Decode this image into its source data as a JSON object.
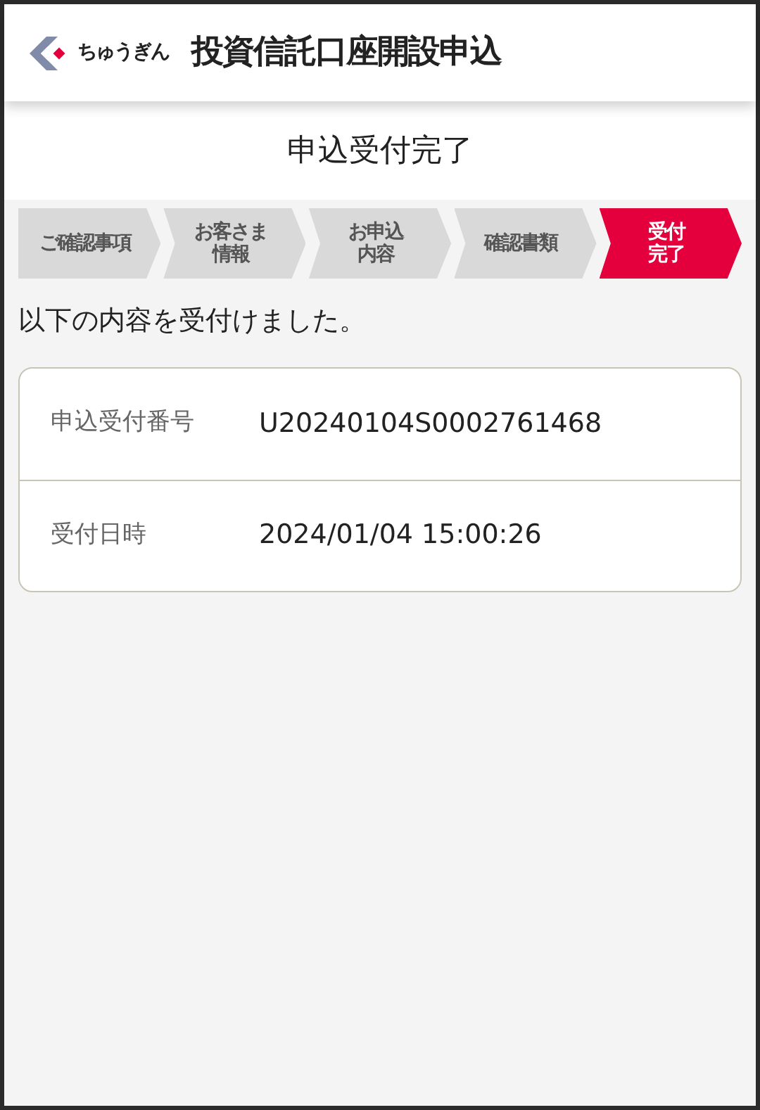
{
  "header": {
    "logo_text": "ちゅうぎん",
    "title": "投資信託口座開設申込"
  },
  "page_title": "申込受付完了",
  "steps": [
    {
      "lines": [
        "ご確認事項"
      ],
      "selected": false
    },
    {
      "lines": [
        "お客さま",
        "情報"
      ],
      "selected": false
    },
    {
      "lines": [
        "お申込",
        "内容"
      ],
      "selected": false
    },
    {
      "lines": [
        "確認書類"
      ],
      "selected": false
    },
    {
      "lines": [
        "受付",
        "完了"
      ],
      "selected": true
    }
  ],
  "message": "以下の内容を受付けました。",
  "details": [
    {
      "label": "申込受付番号",
      "value": "U20240104S0002761468"
    },
    {
      "label": "受付日時",
      "value": "2024/01/04 15:00:26"
    }
  ]
}
